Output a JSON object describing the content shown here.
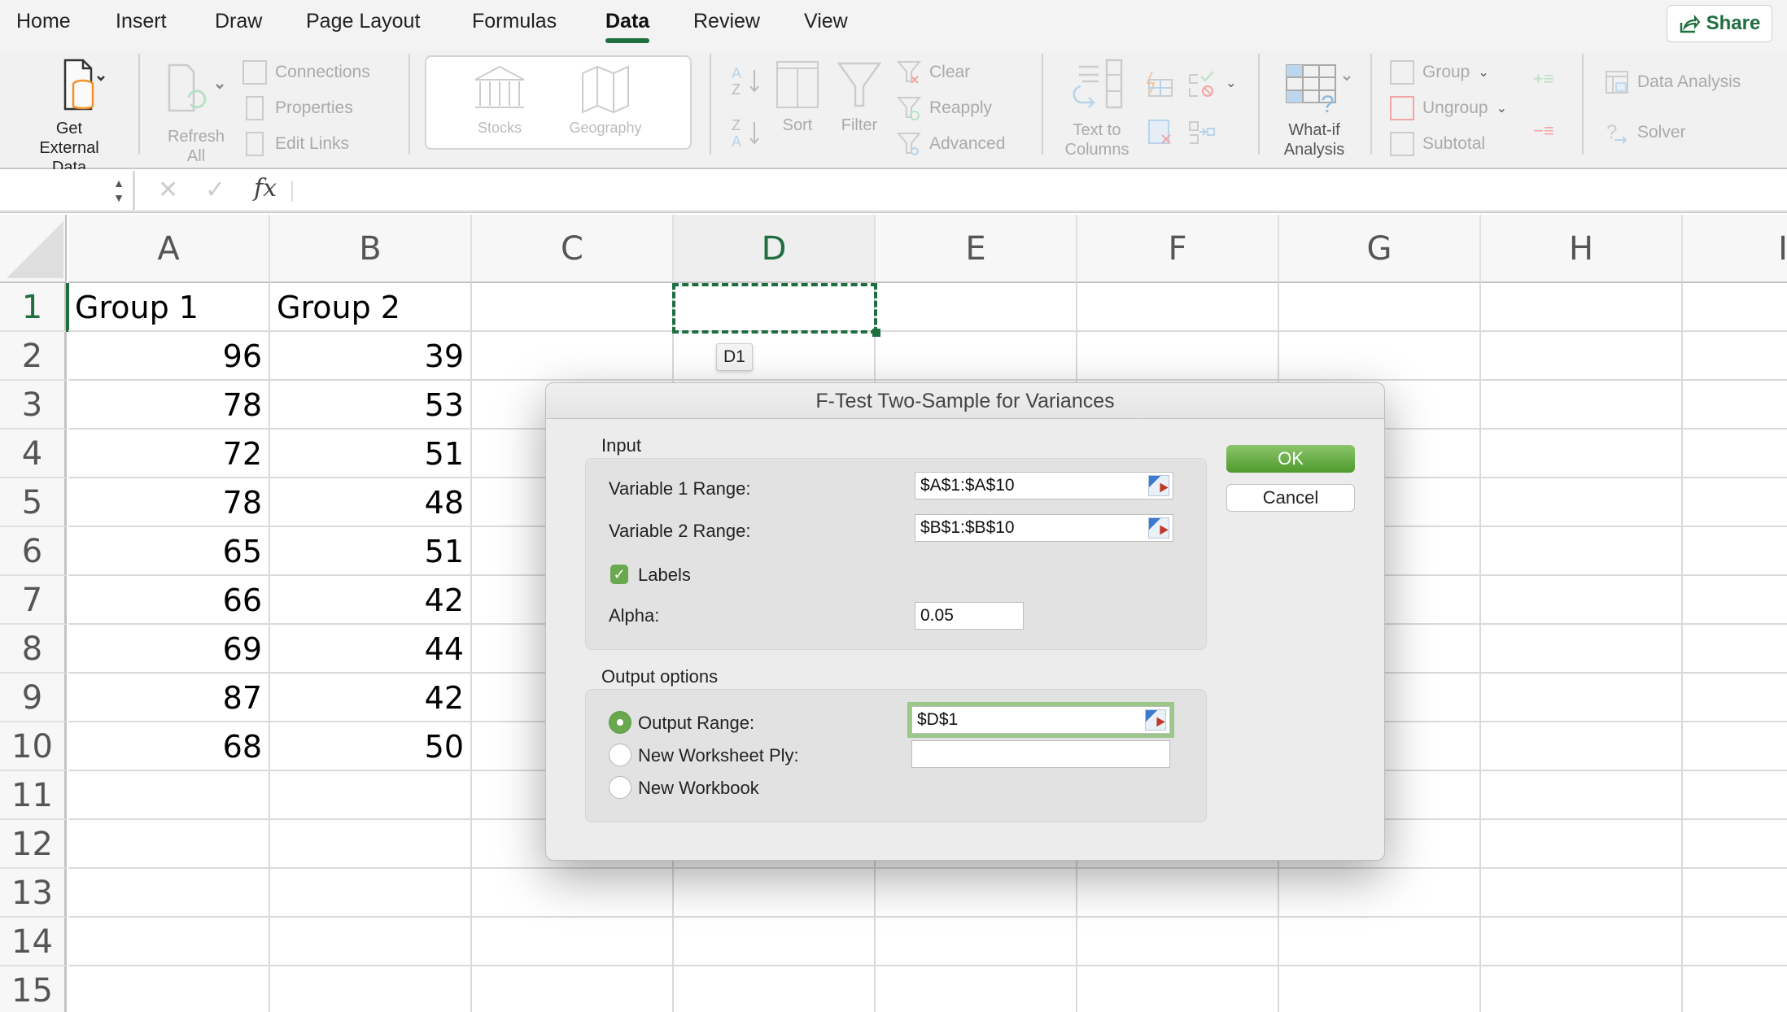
{
  "menu": {
    "tabs": [
      {
        "label": "Home"
      },
      {
        "label": "Insert"
      },
      {
        "label": "Draw"
      },
      {
        "label": "Page Layout"
      },
      {
        "label": "Formulas"
      },
      {
        "label": "Data",
        "active": true
      },
      {
        "label": "Review"
      },
      {
        "label": "View"
      }
    ],
    "share_label": "Share",
    "accent_color": "#1e6e3f"
  },
  "ribbon": {
    "get_external_data": "Get External Data",
    "refresh_all_1": "Refresh",
    "refresh_all_2": "All",
    "connections": "Connections",
    "properties": "Properties",
    "edit_links": "Edit Links",
    "stocks": "Stocks",
    "geography": "Geography",
    "sort": "Sort",
    "filter": "Filter",
    "clear": "Clear",
    "reapply": "Reapply",
    "advanced": "Advanced",
    "text_to_columns_1": "Text to",
    "text_to_columns_2": "Columns",
    "what_if_1": "What-if",
    "what_if_2": "Analysis",
    "group": "Group",
    "ungroup": "Ungroup",
    "subtotal": "Subtotal",
    "data_analysis": "Data Analysis",
    "solver": "Solver"
  },
  "formula_bar": {
    "name_box": "",
    "fx": "fx",
    "formula": ""
  },
  "sheet": {
    "columns": [
      "A",
      "B",
      "C",
      "D",
      "E",
      "F",
      "G",
      "H",
      "I"
    ],
    "rows": [
      "1",
      "2",
      "3",
      "4",
      "5",
      "6",
      "7",
      "8",
      "9",
      "10",
      "11",
      "12",
      "13",
      "14",
      "15"
    ],
    "selected_column": "D",
    "selected_row": "1",
    "cells": {
      "A1": "Group 1",
      "B1": "Group 2",
      "A2": "96",
      "B2": "39",
      "A3": "78",
      "B3": "53",
      "A4": "72",
      "B4": "51",
      "A5": "78",
      "B5": "48",
      "A6": "65",
      "B6": "51",
      "A7": "66",
      "B7": "42",
      "A8": "69",
      "B8": "44",
      "A9": "87",
      "B9": "42",
      "A10": "68",
      "B10": "50"
    },
    "cell_tooltip": "D1"
  },
  "dialog": {
    "title": "F-Test Two-Sample for Variances",
    "input_label": "Input",
    "var1_label": "Variable 1 Range:",
    "var1_value": "$A$1:$A$10",
    "var2_label": "Variable 2 Range:",
    "var2_value": "$B$1:$B$10",
    "labels_label": "Labels",
    "labels_checked": true,
    "alpha_label": "Alpha:",
    "alpha_value": "0.05",
    "output_label": "Output options",
    "output_range_label": "Output Range:",
    "output_range_value": "$D$1",
    "new_ply_label": "New Worksheet Ply:",
    "new_ply_value": "",
    "new_workbook_label": "New Workbook",
    "selected_output": "Output Range",
    "ok_label": "OK",
    "cancel_label": "Cancel"
  }
}
